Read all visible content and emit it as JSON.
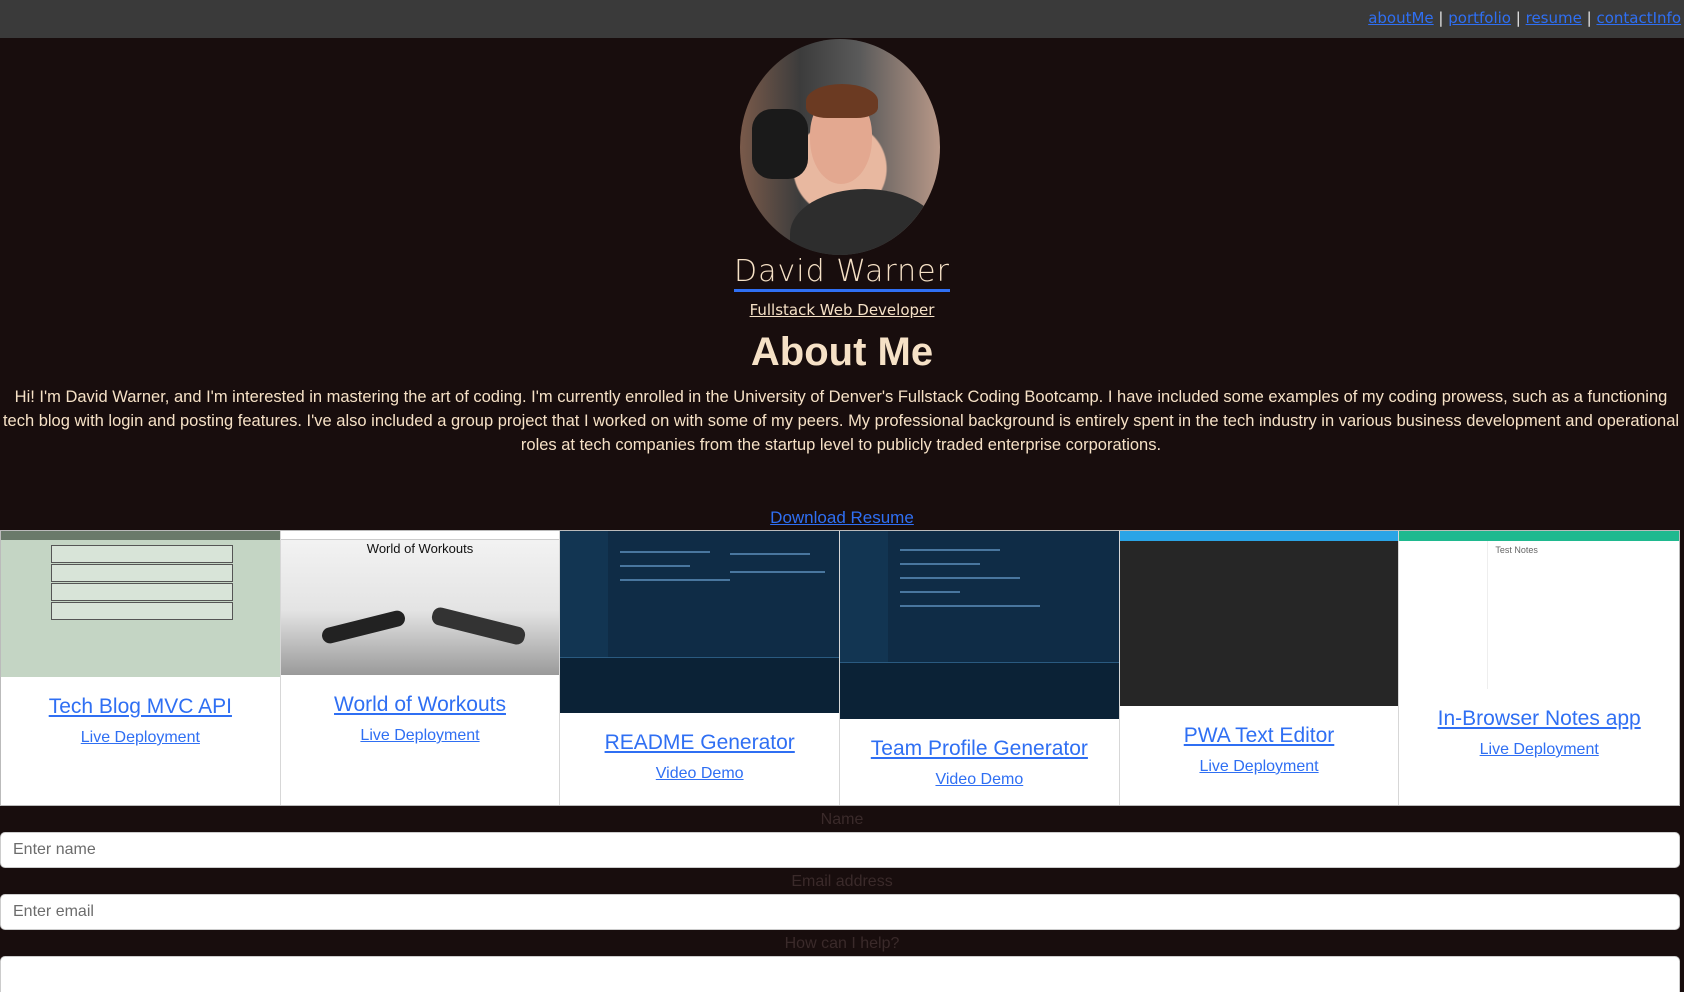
{
  "nav": {
    "links": [
      "aboutMe",
      "portfolio",
      "resume",
      "contactInfo"
    ],
    "separator": "|"
  },
  "profile": {
    "name": "David Warner",
    "tagline": "Fullstack Web Developer"
  },
  "about": {
    "heading": "About Me",
    "text": "Hi! I'm David Warner, and I'm interested in mastering the art of coding. I'm currently enrolled in the University of Denver's Fullstack Coding Bootcamp. I have included some examples of my coding prowess, such as a functioning tech blog with login and posting features. I've also included a group project that I worked on with some of my peers. My professional background is entirely spent in the tech industry in various business development and operational roles at tech companies from the startup level to publicly traded enterprise corporations."
  },
  "resume": {
    "download_label": "Download Resume"
  },
  "portfolio": {
    "cards": [
      {
        "title": "Tech Blog MVC API",
        "link_label": "Live Deployment"
      },
      {
        "title": "World of Workouts",
        "link_label": "Live Deployment",
        "thumb_text": "World of Workouts"
      },
      {
        "title": "README Generator",
        "link_label": "Video Demo"
      },
      {
        "title": "Team Profile Generator",
        "link_label": "Video Demo"
      },
      {
        "title": "PWA Text Editor",
        "link_label": "Live Deployment"
      },
      {
        "title": "In-Browser Notes app",
        "link_label": "Live Deployment",
        "thumb_text": "Test Notes"
      }
    ]
  },
  "contact": {
    "name_label": "Name",
    "name_placeholder": "Enter name",
    "email_label": "Email address",
    "email_placeholder": "Enter email",
    "help_label": "How can I help?"
  },
  "colors": {
    "background": "#180d0d",
    "navbar": "#3a3a3a",
    "link": "#2f6ff3",
    "text": "#f6e1c6"
  }
}
